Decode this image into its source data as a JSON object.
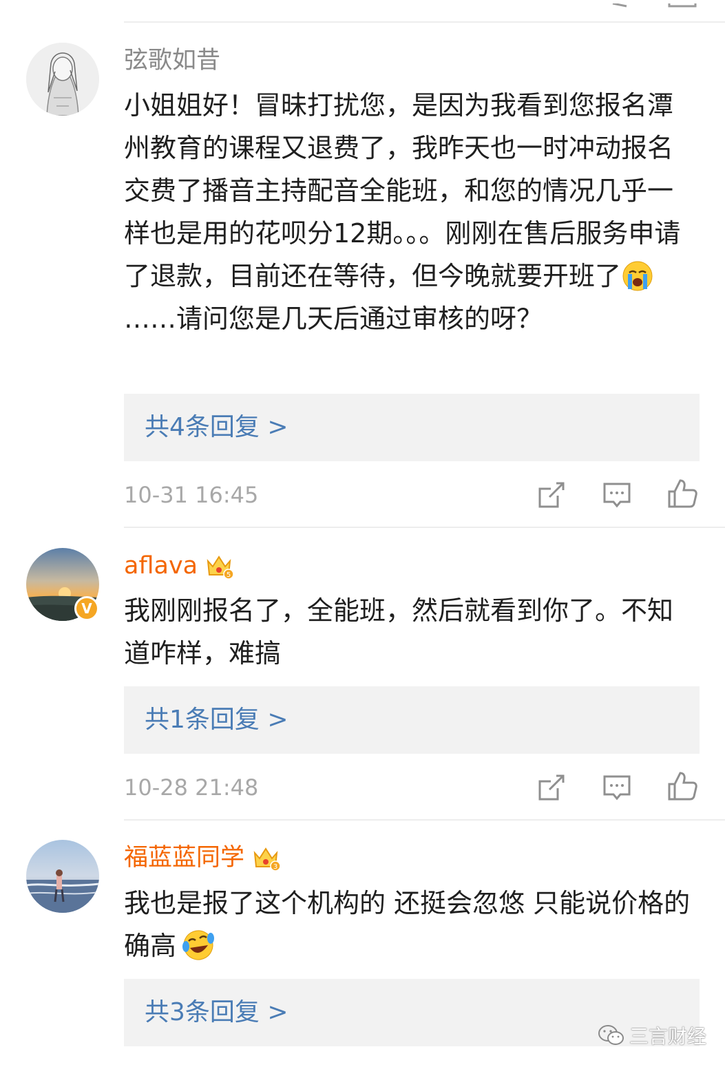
{
  "comments": [
    {
      "username": "弦歌如昔",
      "text_parts": [
        "小姐姐好！冒昧打扰您，是因为我看到您报名潭州教育的课程又退费了，我昨天也一时冲动报名交费了播音主持配音全能班，和您的情况几乎一样也是用的花呗分12期。。。刚刚在售后服务申请了退款，目前还在等待，但今晚就要开班了",
        "……请问您是几天后通过审核的呀？"
      ],
      "emoji": "crying-face",
      "reply_label": "共4条回复 >",
      "time": "10-31 16:45"
    },
    {
      "username": "aflava",
      "vip": true,
      "verified": true,
      "text_parts": [
        "我刚刚报名了，全能班，然后就看到你了。不知道咋样，难搞"
      ],
      "reply_label": "共1条回复 >",
      "time": "10-28 21:48"
    },
    {
      "username": "福蓝蓝同学",
      "vip": true,
      "text_parts": [
        "我也是报了这个机构的 还挺会忽悠 只能说价格的确高",
        ""
      ],
      "emoji": "laughing-tears-face",
      "reply_label": "共3条回复 >"
    }
  ],
  "icons": {
    "share": "share-icon",
    "comment": "comment-icon",
    "like": "like-icon"
  },
  "colors": {
    "vip_name": "#f46600",
    "name": "#8a8a8a",
    "link": "#4a7cb5",
    "reply_bg": "#f2f2f2"
  },
  "watermark": "三言财经"
}
